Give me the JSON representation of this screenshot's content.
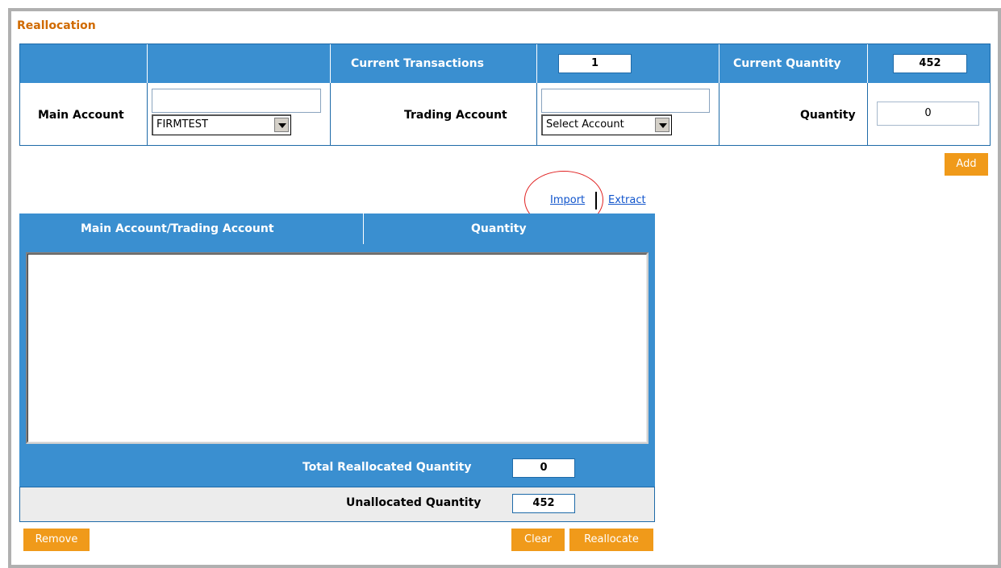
{
  "section_title": "Reallocation",
  "header": {
    "current_transactions_label": "Current Transactions",
    "current_transactions_value": "1",
    "current_quantity_label": "Current Quantity",
    "current_quantity_value": "452"
  },
  "form": {
    "main_account_label": "Main Account",
    "main_account_input_value": "",
    "main_account_select_value": "FIRMTEST",
    "trading_account_label": "Trading Account",
    "trading_account_input_value": "",
    "trading_account_select_value": "Select Account",
    "quantity_label": "Quantity",
    "quantity_value": "0"
  },
  "buttons": {
    "add": "Add",
    "remove": "Remove",
    "clear": "Clear",
    "reallocate": "Reallocate"
  },
  "links": {
    "import": "Import",
    "extract": "Extract"
  },
  "allocation_table": {
    "columns": [
      "Main Account/Trading Account",
      "Quantity"
    ],
    "rows": []
  },
  "totals": {
    "total_reallocated_label": "Total Reallocated Quantity",
    "total_reallocated_value": "0",
    "unallocated_label": "Unallocated Quantity",
    "unallocated_value": "452"
  },
  "colors": {
    "accent_blue": "#3a8fd0",
    "button_orange": "#f09a1a",
    "title_orange": "#d06a00",
    "highlight_circle": "#e02020"
  }
}
